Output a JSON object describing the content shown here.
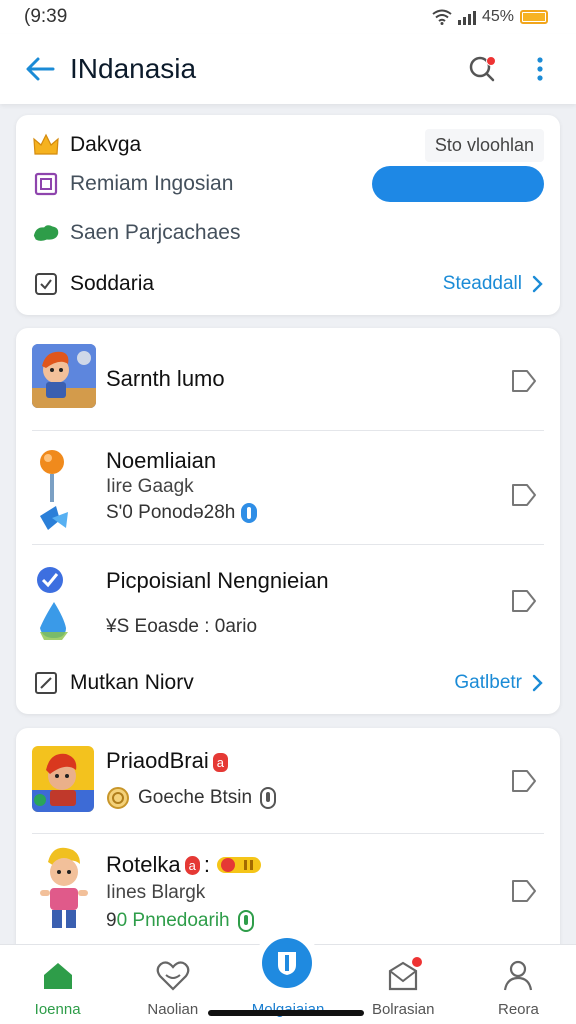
{
  "status_bar": {
    "time": "(9:39",
    "battery": "45%"
  },
  "app_bar": {
    "title": "INdanasia"
  },
  "summary": {
    "row1": {
      "label": "Dakvga",
      "right": "Sto vloohlan"
    },
    "row2": {
      "label": "Remiam Ingosian"
    },
    "row3": {
      "label": "Saen Parjcachaes"
    },
    "row4": {
      "label": "Soddaria",
      "link": "Steaddall"
    }
  },
  "list": {
    "item1": {
      "title": "Sarnth lumo"
    },
    "item2": {
      "title": "Noemliaian",
      "line1": "Iire Gaagk",
      "line2": "S'0 Ponodə28h"
    },
    "item3": {
      "title": "Picpoisianl Nengnieian",
      "line1": "¥S Eoasde : 0ario"
    },
    "footer": {
      "label": "Mutkan Niorv",
      "link": "Gatlbetr"
    }
  },
  "list2": {
    "item1": {
      "title": "PriaodBrai",
      "badge": "a",
      "line1": "Goeche Btsin"
    },
    "item2": {
      "title": "Rotelka",
      "badge": "a",
      "colon": ":",
      "line1": "Iines Blargk",
      "line2_prefix": "9",
      "line2": " 0 Pnnedoarih"
    }
  },
  "bottom_nav": {
    "home": "Ioenna",
    "fav": "Naolian",
    "center": "Molgaiaian",
    "inbox": "Bolrasian",
    "profile": "Reora"
  },
  "colors": {
    "accent": "#1f8ae0",
    "active_nav": "#2e9d49",
    "link": "#1b8bd6"
  }
}
